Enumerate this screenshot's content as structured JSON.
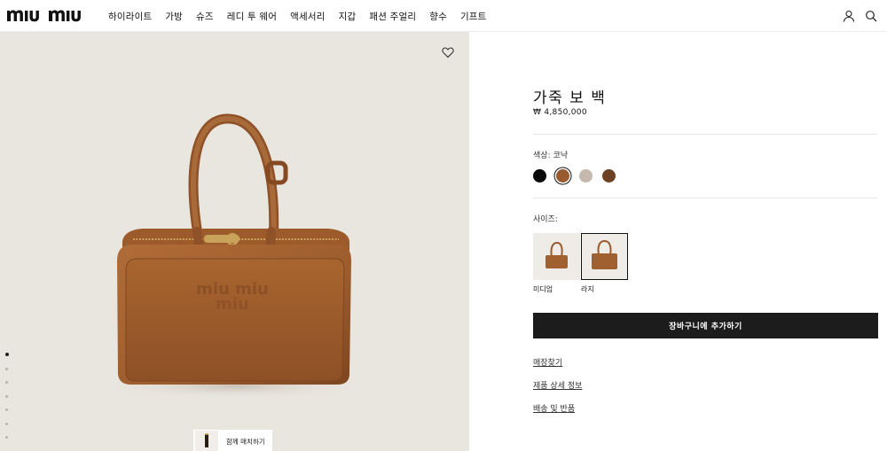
{
  "header": {
    "logo_text": "miu miu",
    "nav": [
      "하이라이트",
      "가방",
      "슈즈",
      "레디 투 웨어",
      "액세서리",
      "지갑",
      "패션 주얼리",
      "향수",
      "기프트"
    ],
    "icons": [
      "user-icon",
      "search-icon"
    ]
  },
  "gallery": {
    "favorite_icon": "heart-icon",
    "dot_count": 7,
    "active_dot": 0,
    "match_label": "함께 매치하기"
  },
  "product": {
    "title": "가죽 보 백",
    "price": "₩ 4,850,000",
    "color_label": "색상: 코냑",
    "colors": [
      {
        "name": "black",
        "hex": "#0b0b0b",
        "selected": false
      },
      {
        "name": "cognac",
        "hex": "#9a5a2f",
        "selected": true
      },
      {
        "name": "taupe",
        "hex": "#c5b8ad",
        "selected": false
      },
      {
        "name": "brown",
        "hex": "#6d4224",
        "selected": false
      }
    ],
    "size_label": "사이즈:",
    "sizes": [
      {
        "label": "미디엄",
        "selected": false
      },
      {
        "label": "라지",
        "selected": true
      }
    ],
    "cart_button": "장바구니에 추가하기",
    "links": [
      "매장찾기",
      "제품 상세 정보",
      "배송 및 반품"
    ]
  },
  "colors": {
    "image_bg": "#e9e5df",
    "bag": "#a0602f",
    "button_bg": "#1c1c1c"
  }
}
